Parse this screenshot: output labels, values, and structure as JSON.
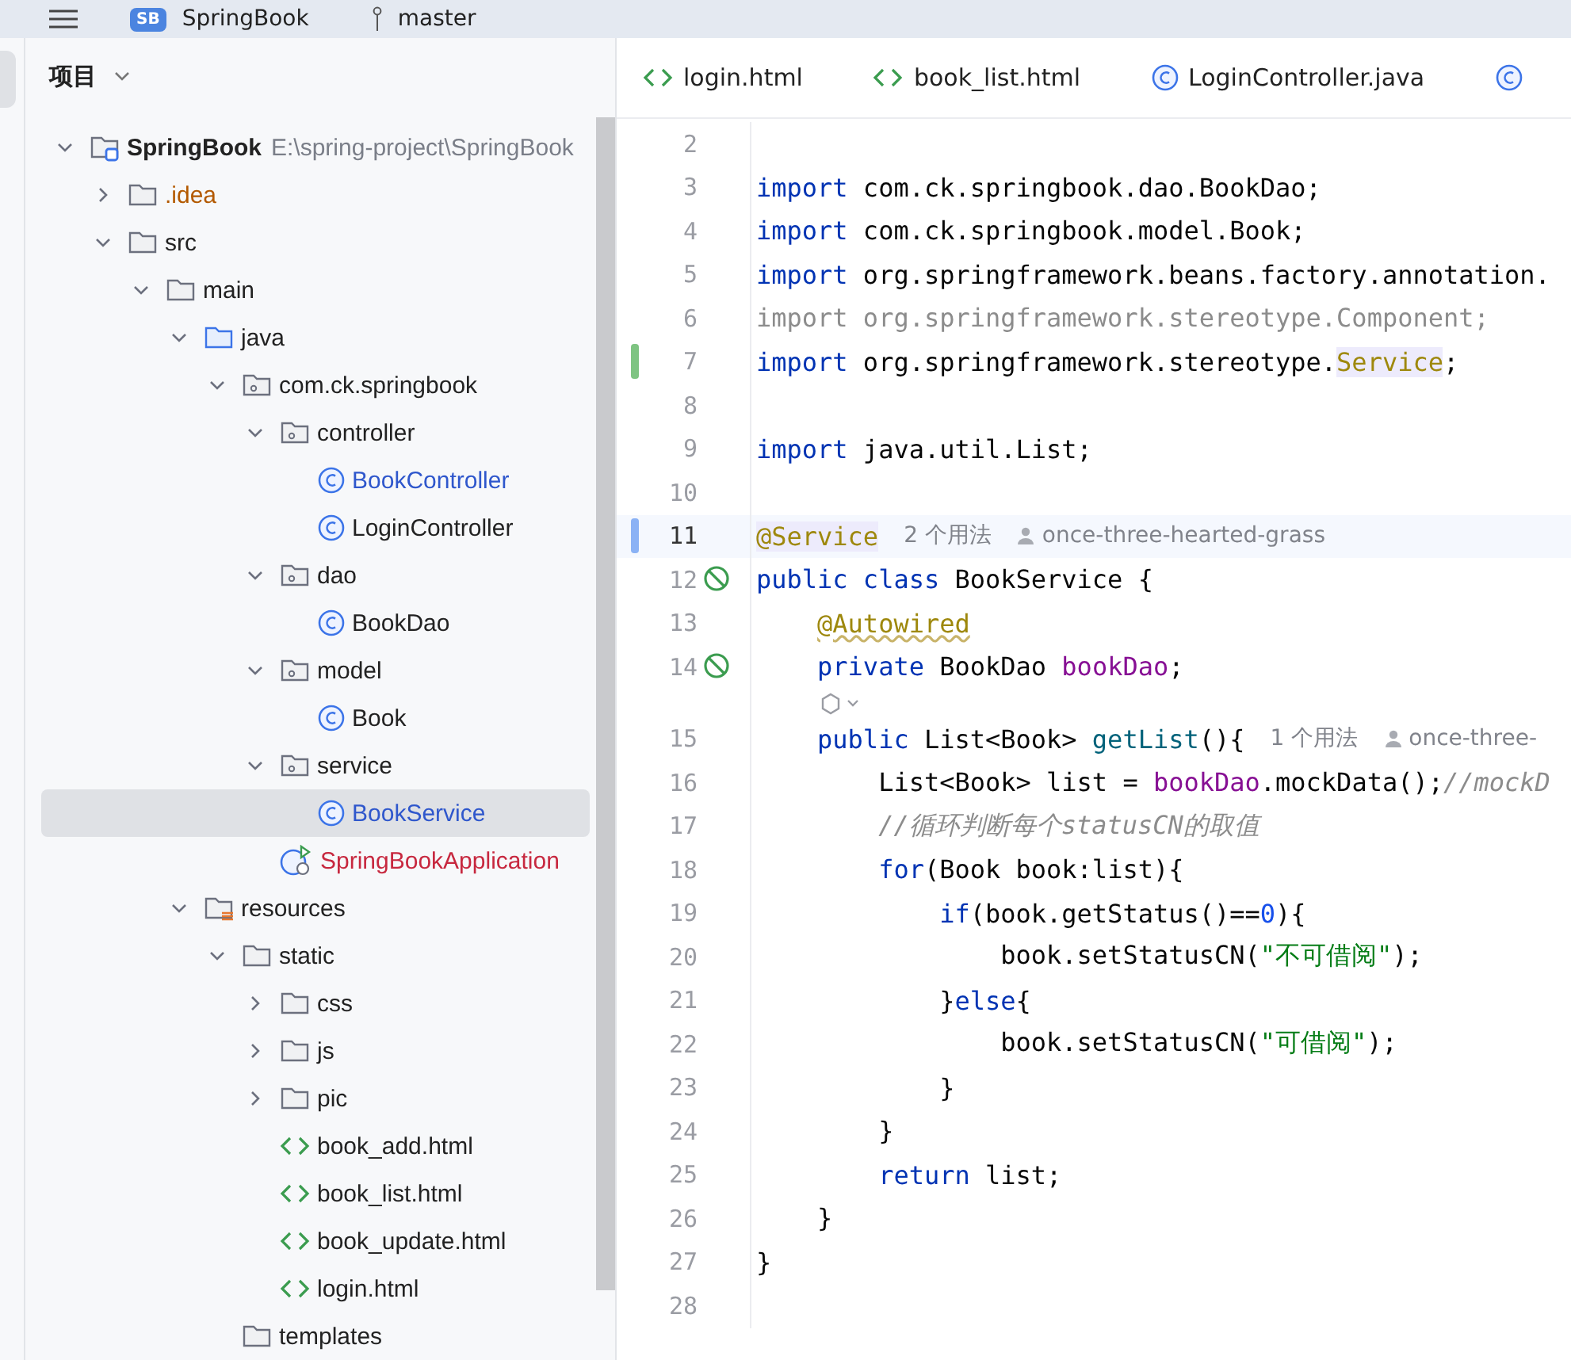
{
  "top_bar": {
    "project_badge": "SB",
    "project": "SpringBook",
    "branch": "master"
  },
  "project_panel": {
    "title": "项目",
    "tree": [
      {
        "label": "SpringBook",
        "path": "E:\\spring-project\\SpringBook",
        "kind": "project",
        "color": "#222222",
        "expanded": true,
        "selected": false,
        "children": [
          {
            "label": ".idea",
            "kind": "folder",
            "color": "#b35900",
            "expanded": false,
            "selected": false
          },
          {
            "label": "src",
            "kind": "folder",
            "color": "#222222",
            "expanded": true,
            "selected": false,
            "children": [
              {
                "label": "main",
                "kind": "folder",
                "color": "#222222",
                "expanded": true,
                "selected": false,
                "children": [
                  {
                    "label": "java",
                    "kind": "source",
                    "color": "#222222",
                    "expanded": true,
                    "selected": false,
                    "children": [
                      {
                        "label": "com.ck.springbook",
                        "kind": "package",
                        "color": "#222222",
                        "expanded": true,
                        "selected": false,
                        "children": [
                          {
                            "label": "controller",
                            "kind": "package",
                            "color": "#222222",
                            "expanded": true,
                            "selected": false,
                            "children": [
                              {
                                "label": "BookController",
                                "kind": "class",
                                "color": "#2f57cc",
                                "selected": false
                              },
                              {
                                "label": "LoginController",
                                "kind": "class",
                                "color": "#222222",
                                "selected": false
                              }
                            ]
                          },
                          {
                            "label": "dao",
                            "kind": "package",
                            "color": "#222222",
                            "expanded": true,
                            "selected": false,
                            "children": [
                              {
                                "label": "BookDao",
                                "kind": "class",
                                "color": "#222222",
                                "selected": false
                              }
                            ]
                          },
                          {
                            "label": "model",
                            "kind": "package",
                            "color": "#222222",
                            "expanded": true,
                            "selected": false,
                            "children": [
                              {
                                "label": "Book",
                                "kind": "class",
                                "color": "#222222",
                                "selected": false
                              }
                            ]
                          },
                          {
                            "label": "service",
                            "kind": "package",
                            "color": "#222222",
                            "expanded": true,
                            "selected": false,
                            "children": [
                              {
                                "label": "BookService",
                                "kind": "class",
                                "color": "#2f57cc",
                                "selected": true
                              }
                            ]
                          },
                          {
                            "label": "SpringBookApplication",
                            "kind": "application",
                            "color": "#c7283f",
                            "selected": false
                          }
                        ]
                      }
                    ]
                  },
                  {
                    "label": "resources",
                    "kind": "resources",
                    "color": "#222222",
                    "expanded": true,
                    "selected": false,
                    "children": [
                      {
                        "label": "static",
                        "kind": "folder",
                        "color": "#222222",
                        "expanded": true,
                        "selected": false,
                        "children": [
                          {
                            "label": "css",
                            "kind": "folder",
                            "color": "#222222",
                            "expanded": false,
                            "selected": false
                          },
                          {
                            "label": "js",
                            "kind": "folder",
                            "color": "#222222",
                            "expanded": false,
                            "selected": false
                          },
                          {
                            "label": "pic",
                            "kind": "folder",
                            "color": "#222222",
                            "expanded": false,
                            "selected": false
                          },
                          {
                            "label": "book_add.html",
                            "kind": "html",
                            "color": "#222222",
                            "selected": false
                          },
                          {
                            "label": "book_list.html",
                            "kind": "html",
                            "color": "#222222",
                            "selected": false
                          },
                          {
                            "label": "book_update.html",
                            "kind": "html",
                            "color": "#222222",
                            "selected": false
                          },
                          {
                            "label": "login.html",
                            "kind": "html",
                            "color": "#222222",
                            "selected": false
                          }
                        ]
                      },
                      {
                        "label": "templates",
                        "kind": "folder",
                        "color": "#222222",
                        "selected": false
                      }
                    ]
                  }
                ]
              }
            ]
          }
        ]
      }
    ]
  },
  "editor": {
    "tabs": [
      {
        "label": "login.html",
        "kind": "html",
        "selected": false
      },
      {
        "label": "book_list.html",
        "kind": "html",
        "selected": false
      },
      {
        "label": "LoginController.java",
        "kind": "class",
        "selected": false
      },
      {
        "kind": "class",
        "selected": false
      }
    ],
    "lines": [
      {
        "number": "2",
        "current": false
      },
      {
        "number": "3",
        "current": false,
        "tokens": [
          {
            "kind": "keyword",
            "text": "import"
          },
          {
            "kind": "plain",
            "text": " com.ck.springbook.dao.BookDao;"
          }
        ]
      },
      {
        "number": "4",
        "current": false,
        "tokens": [
          {
            "kind": "keyword",
            "text": "import"
          },
          {
            "kind": "plain",
            "text": " com.ck.springbook.model.Book;"
          }
        ]
      },
      {
        "number": "5",
        "current": false,
        "tokens": [
          {
            "kind": "keyword",
            "text": "import"
          },
          {
            "kind": "plain",
            "text": " org.springframework.beans.factory.annotation."
          }
        ]
      },
      {
        "number": "6",
        "current": false,
        "tokens": [
          {
            "kind": "unused",
            "text": "import org.springframework.stereotype.Component;"
          }
        ]
      },
      {
        "number": "7",
        "current": false,
        "color": "#7ec482",
        "tokens": [
          {
            "kind": "keyword",
            "text": "import"
          },
          {
            "kind": "plain",
            "text": " org.springframework.stereotype."
          },
          {
            "kind": "annotation-highlight",
            "text": "Service"
          },
          {
            "kind": "plain",
            "text": ";"
          }
        ]
      },
      {
        "number": "8",
        "current": false
      },
      {
        "number": "9",
        "current": false,
        "tokens": [
          {
            "kind": "keyword",
            "text": "import"
          },
          {
            "kind": "plain",
            "text": " java.util.List;"
          }
        ]
      },
      {
        "number": "10",
        "current": false
      },
      {
        "number": "11",
        "current": true,
        "color": "#8bb2f5",
        "tokens": [
          {
            "kind": "annotation-highlight",
            "text": "@Service"
          }
        ],
        "usages": "2 个用法",
        "author": "once-three-hearted-grass"
      },
      {
        "number": "12",
        "current": false,
        "gutter_icon": true,
        "tokens": [
          {
            "kind": "keyword",
            "text": "public class"
          },
          {
            "kind": "plain",
            "text": " BookService {"
          }
        ]
      },
      {
        "number": "13",
        "current": false,
        "tokens": [
          {
            "kind": "annotation-warn",
            "text": "    @Autowired"
          }
        ]
      },
      {
        "number": "14",
        "current": false,
        "gutter_icon": true,
        "tokens": [
          {
            "kind": "keyword",
            "text": "    private"
          },
          {
            "kind": "plain",
            "text": " BookDao "
          },
          {
            "kind": "field",
            "text": "bookDao"
          },
          {
            "kind": "plain",
            "text": ";"
          }
        ]
      },
      {
        "kind": "inlay"
      },
      {
        "number": "15",
        "current": false,
        "tokens": [
          {
            "kind": "keyword",
            "text": "    public"
          },
          {
            "kind": "plain",
            "text": " List<Book> "
          },
          {
            "kind": "method",
            "text": "getList"
          },
          {
            "kind": "plain",
            "text": "(){"
          }
        ],
        "usages": "1 个用法",
        "author": "once-three-"
      },
      {
        "number": "16",
        "current": false,
        "tokens": [
          {
            "kind": "plain",
            "text": "        List<Book> list = "
          },
          {
            "kind": "field",
            "text": "bookDao"
          },
          {
            "kind": "plain",
            "text": ".mockData();"
          },
          {
            "kind": "comment",
            "text": "//mockD"
          }
        ]
      },
      {
        "number": "17",
        "current": false,
        "tokens": [
          {
            "kind": "comment",
            "text": "        //循环判断每个statusCN的取值"
          }
        ]
      },
      {
        "number": "18",
        "current": false,
        "tokens": [
          {
            "kind": "keyword",
            "text": "        for"
          },
          {
            "kind": "plain",
            "text": "(Book book:list){"
          }
        ]
      },
      {
        "number": "19",
        "current": false,
        "tokens": [
          {
            "kind": "keyword",
            "text": "            if"
          },
          {
            "kind": "plain",
            "text": "(book.getStatus()=="
          },
          {
            "kind": "number",
            "text": "0"
          },
          {
            "kind": "plain",
            "text": "){"
          }
        ]
      },
      {
        "number": "20",
        "current": false,
        "tokens": [
          {
            "kind": "plain",
            "text": "                book.setStatusCN("
          },
          {
            "kind": "string",
            "text": "\"不可借阅\""
          },
          {
            "kind": "plain",
            "text": ");"
          }
        ]
      },
      {
        "number": "21",
        "current": false,
        "tokens": [
          {
            "kind": "plain",
            "text": "            }"
          },
          {
            "kind": "keyword",
            "text": "else"
          },
          {
            "kind": "plain",
            "text": "{"
          }
        ]
      },
      {
        "number": "22",
        "current": false,
        "tokens": [
          {
            "kind": "plain",
            "text": "                book.setStatusCN("
          },
          {
            "kind": "string",
            "text": "\"可借阅\""
          },
          {
            "kind": "plain",
            "text": ");"
          }
        ]
      },
      {
        "number": "23",
        "current": false,
        "tokens": [
          {
            "kind": "plain",
            "text": "            }"
          }
        ]
      },
      {
        "number": "24",
        "current": false,
        "tokens": [
          {
            "kind": "plain",
            "text": "        }"
          }
        ]
      },
      {
        "number": "25",
        "current": false,
        "tokens": [
          {
            "kind": "keyword",
            "text": "        return"
          },
          {
            "kind": "plain",
            "text": " list;"
          }
        ]
      },
      {
        "number": "26",
        "current": false,
        "tokens": [
          {
            "kind": "plain",
            "text": "    }"
          }
        ]
      },
      {
        "number": "27",
        "current": false,
        "tokens": [
          {
            "kind": "plain",
            "text": "}"
          }
        ]
      },
      {
        "number": "28",
        "current": false
      }
    ]
  }
}
